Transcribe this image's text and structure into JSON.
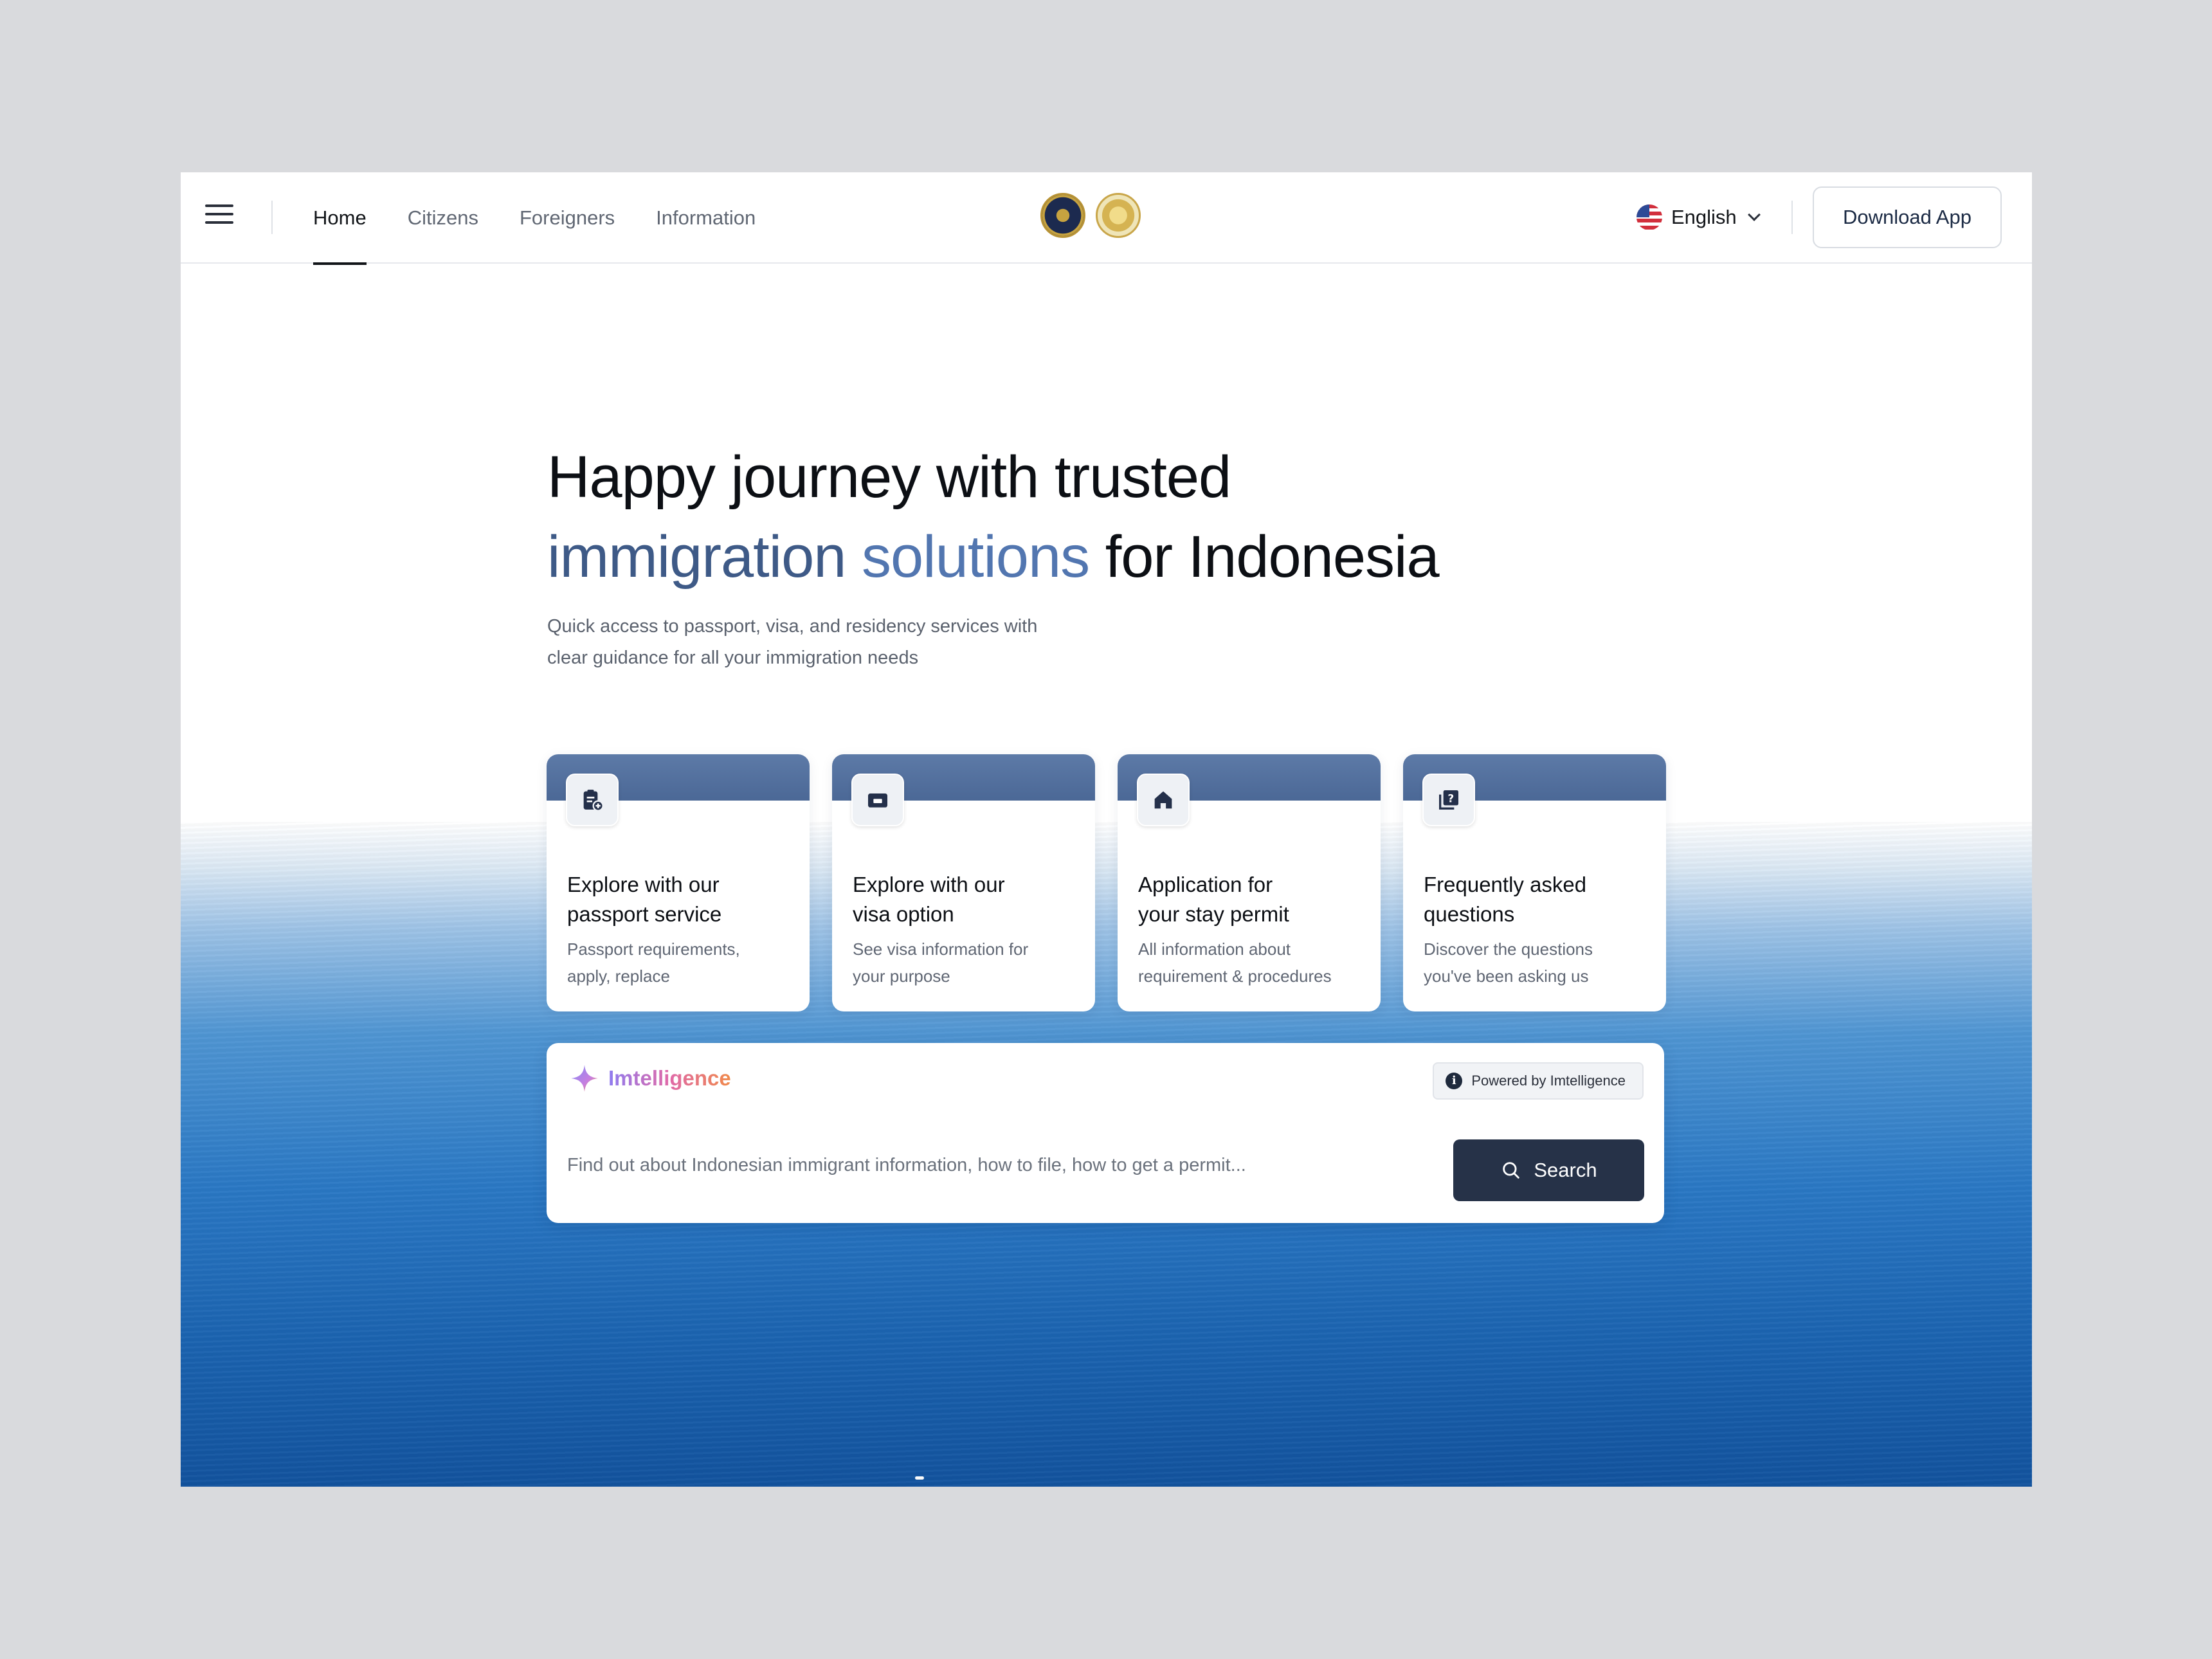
{
  "header": {
    "nav": [
      {
        "label": "Home",
        "active": true
      },
      {
        "label": "Citizens",
        "active": false
      },
      {
        "label": "Foreigners",
        "active": false
      },
      {
        "label": "Information",
        "active": false
      }
    ],
    "language": "English",
    "download_label": "Download App"
  },
  "hero": {
    "title_line1": "Happy journey with trusted",
    "title_accent1": "immigration",
    "title_accent2": "solutions",
    "title_rest": "for Indonesia",
    "subtitle_line1": "Quick access to passport, visa, and residency services with",
    "subtitle_line2": "clear guidance for all your immigration needs"
  },
  "cards": [
    {
      "icon": "clipboard-add-icon",
      "title_l1": "Explore with our",
      "title_l2": "passport service",
      "desc_l1": "Passport requirements,",
      "desc_l2": "apply, replace"
    },
    {
      "icon": "card-icon",
      "title_l1": "Explore with our",
      "title_l2": "visa option",
      "desc_l1": "See visa information for",
      "desc_l2": "your purpose"
    },
    {
      "icon": "home-icon",
      "title_l1": "Application for",
      "title_l2": "your stay permit",
      "desc_l1": "All information about",
      "desc_l2": "requirement & procedures"
    },
    {
      "icon": "question-book-icon",
      "title_l1": "Frequently asked",
      "title_l2": "questions",
      "desc_l1": "Discover the questions",
      "desc_l2": "you've been asking us"
    }
  ],
  "assistant": {
    "brand": "Imtelligence",
    "powered_by": "Powered by Imtelligence",
    "placeholder": "Find out about Indonesian immigrant information, how to file, how to get a permit...",
    "search_label": "Search"
  },
  "colors": {
    "accent": "#3e5a87",
    "card_header": "#4b6896",
    "search_button": "#263248"
  }
}
